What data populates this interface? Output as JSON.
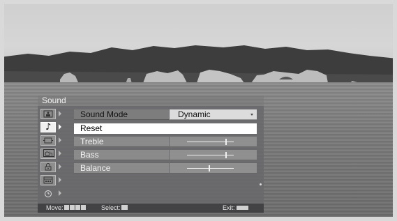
{
  "menu": {
    "title": "Sound",
    "sidebar": [
      {
        "icon": "picture-icon",
        "active": false
      },
      {
        "icon": "music-note-icon",
        "active": true,
        "glyph": "♪"
      },
      {
        "icon": "screen-icon",
        "active": false
      },
      {
        "icon": "channel-icon",
        "active": false,
        "glyph": "Ch"
      },
      {
        "icon": "lock-icon",
        "active": false
      },
      {
        "icon": "setup-icon",
        "active": false
      },
      {
        "icon": "clock-icon",
        "active": false
      }
    ],
    "rows": {
      "sound_mode": {
        "label": "Sound Mode",
        "value": "Dynamic"
      },
      "reset": {
        "label": "Reset"
      },
      "treble": {
        "label": "Treble",
        "level": 0.83
      },
      "bass": {
        "label": "Bass",
        "level": 0.83
      },
      "balance": {
        "label": "Balance",
        "level": 0.48
      }
    },
    "footer": {
      "move_label": "Move:",
      "select_label": "Select:",
      "exit_label": "Exit:",
      "exit_key": "MENU"
    }
  },
  "colors": {
    "highlight": "#ffffff",
    "panel": "#68686c",
    "title_bar": "#787878"
  }
}
